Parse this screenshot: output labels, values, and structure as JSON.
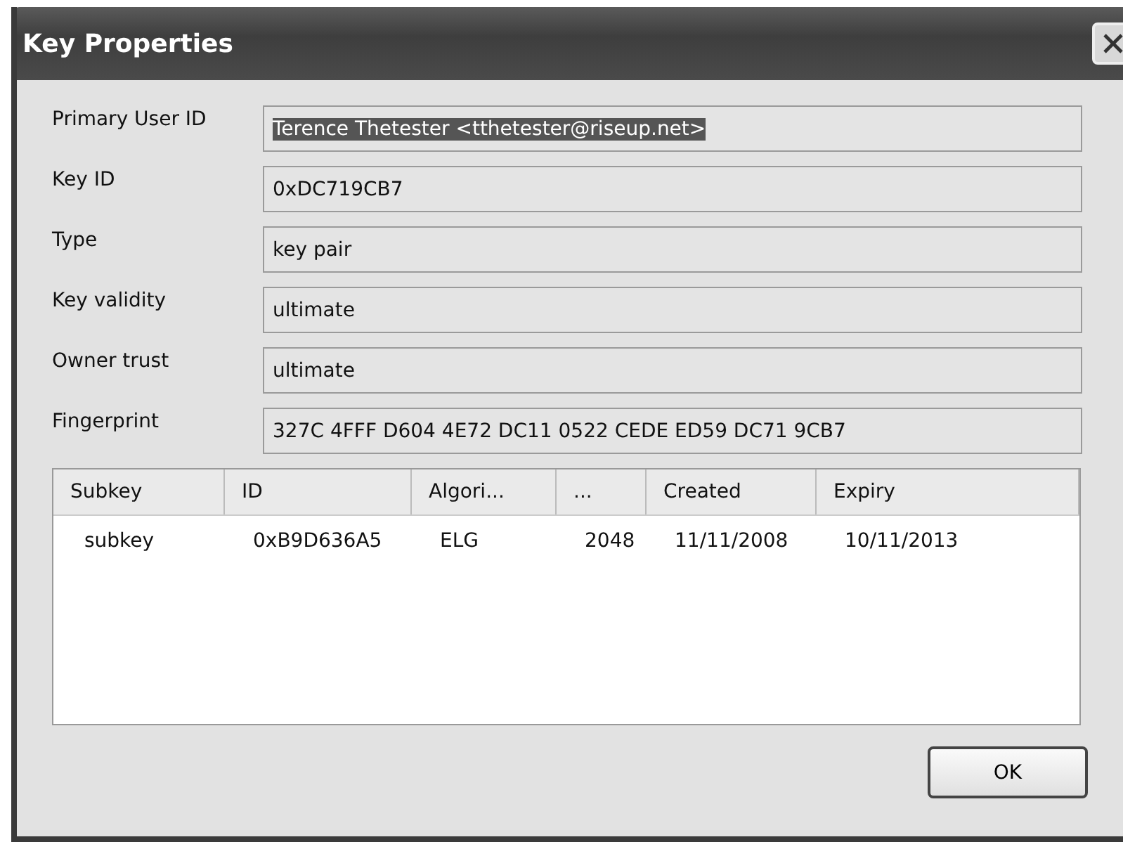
{
  "window": {
    "title": "Key Properties"
  },
  "fields": [
    {
      "label": "Primary User ID",
      "value": "Terence Thetester <tthetester@riseup.net>",
      "selected": true
    },
    {
      "label": "Key ID",
      "value": "0xDC719CB7",
      "selected": false
    },
    {
      "label": "Type",
      "value": "key pair",
      "selected": false
    },
    {
      "label": "Key validity",
      "value": "ultimate",
      "selected": false
    },
    {
      "label": "Owner trust",
      "value": "ultimate",
      "selected": false
    },
    {
      "label": "Fingerprint",
      "value": "327C 4FFF D604 4E72 DC11 0522 CEDE ED59 DC71 9CB7",
      "selected": false
    }
  ],
  "table": {
    "columns": [
      "Subkey",
      "ID",
      "Algori...",
      "...",
      "Created",
      "Expiry"
    ],
    "rows": [
      [
        "subkey",
        "0xB9D636A5",
        "ELG",
        "2048",
        "11/11/2008",
        "10/11/2013"
      ]
    ]
  },
  "buttons": [
    "OK"
  ]
}
